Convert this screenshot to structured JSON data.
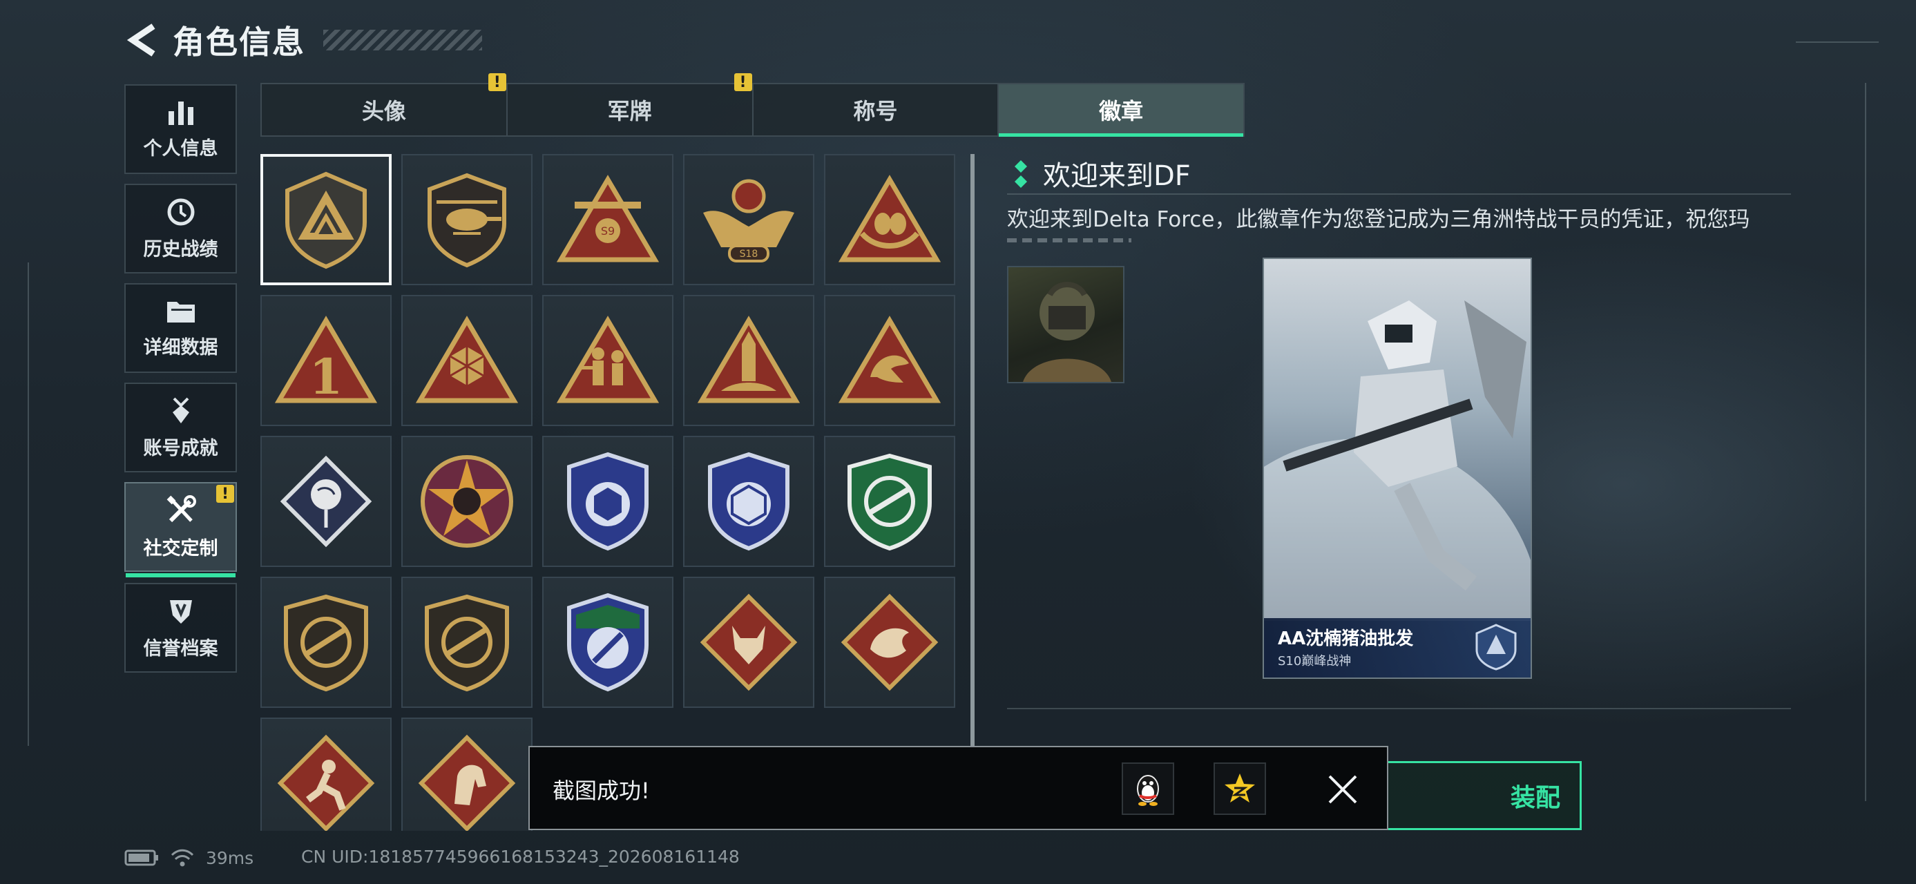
{
  "header": {
    "title": "角色信息"
  },
  "sidebar": {
    "items": [
      {
        "label": "个人信息",
        "icon": "bar-chart-icon",
        "active": false
      },
      {
        "label": "历史战绩",
        "icon": "clock-icon",
        "active": false
      },
      {
        "label": "详细数据",
        "icon": "folder-icon",
        "active": false
      },
      {
        "label": "账号成就",
        "icon": "medal-icon",
        "active": false
      },
      {
        "label": "社交定制",
        "icon": "tools-icon",
        "active": true,
        "alert": "!"
      },
      {
        "label": "信誉档案",
        "icon": "shield-icon",
        "active": false
      }
    ]
  },
  "tabs": [
    {
      "label": "头像",
      "alert": "!"
    },
    {
      "label": "军牌",
      "alert": "!"
    },
    {
      "label": "称号"
    },
    {
      "label": "徽章",
      "active": true
    }
  ],
  "badges": [
    {
      "name": "delta-shield-badge",
      "selected": true
    },
    {
      "name": "helicopter-badge"
    },
    {
      "name": "s9-biplane-badge"
    },
    {
      "name": "s18-eagle-badge"
    },
    {
      "name": "nest-egg-badge"
    },
    {
      "name": "number-one-badge"
    },
    {
      "name": "d20-dice-badge"
    },
    {
      "name": "soldiers-badge"
    },
    {
      "name": "rocket-badge"
    },
    {
      "name": "koi-fish-badge"
    },
    {
      "name": "rose-badge"
    },
    {
      "name": "skull-star-badge"
    },
    {
      "name": "blue-hex-crest-badge"
    },
    {
      "name": "blue-d20-crest-badge"
    },
    {
      "name": "green-rifle-crest-badge"
    },
    {
      "name": "rifle-crosshair-badge"
    },
    {
      "name": "rifle-crosshair-badge-2"
    },
    {
      "name": "knife-crest-badge"
    },
    {
      "name": "wolf-badge"
    },
    {
      "name": "dragon-badge"
    },
    {
      "name": "runner-badge"
    },
    {
      "name": "horse-badge"
    }
  ],
  "detail": {
    "title": "欢迎来到DF",
    "description": "欢迎来到Delta Force，此徽章作为您登记成为三角洲特战干员的凭证，祝您玛",
    "card": {
      "name": "AA沈楠猪油批发",
      "subtitle": "S10巅峰战神"
    }
  },
  "equip_button": {
    "label": "装配"
  },
  "toast": {
    "message": "截图成功!"
  },
  "status": {
    "ping": "39ms",
    "uid": "CN UID:181857745966168153243_202608161148"
  },
  "colors": {
    "accent": "#36e3a3",
    "alert": "#e7c336",
    "gold": "#c9a458",
    "badge_red": "#8a2e25"
  }
}
